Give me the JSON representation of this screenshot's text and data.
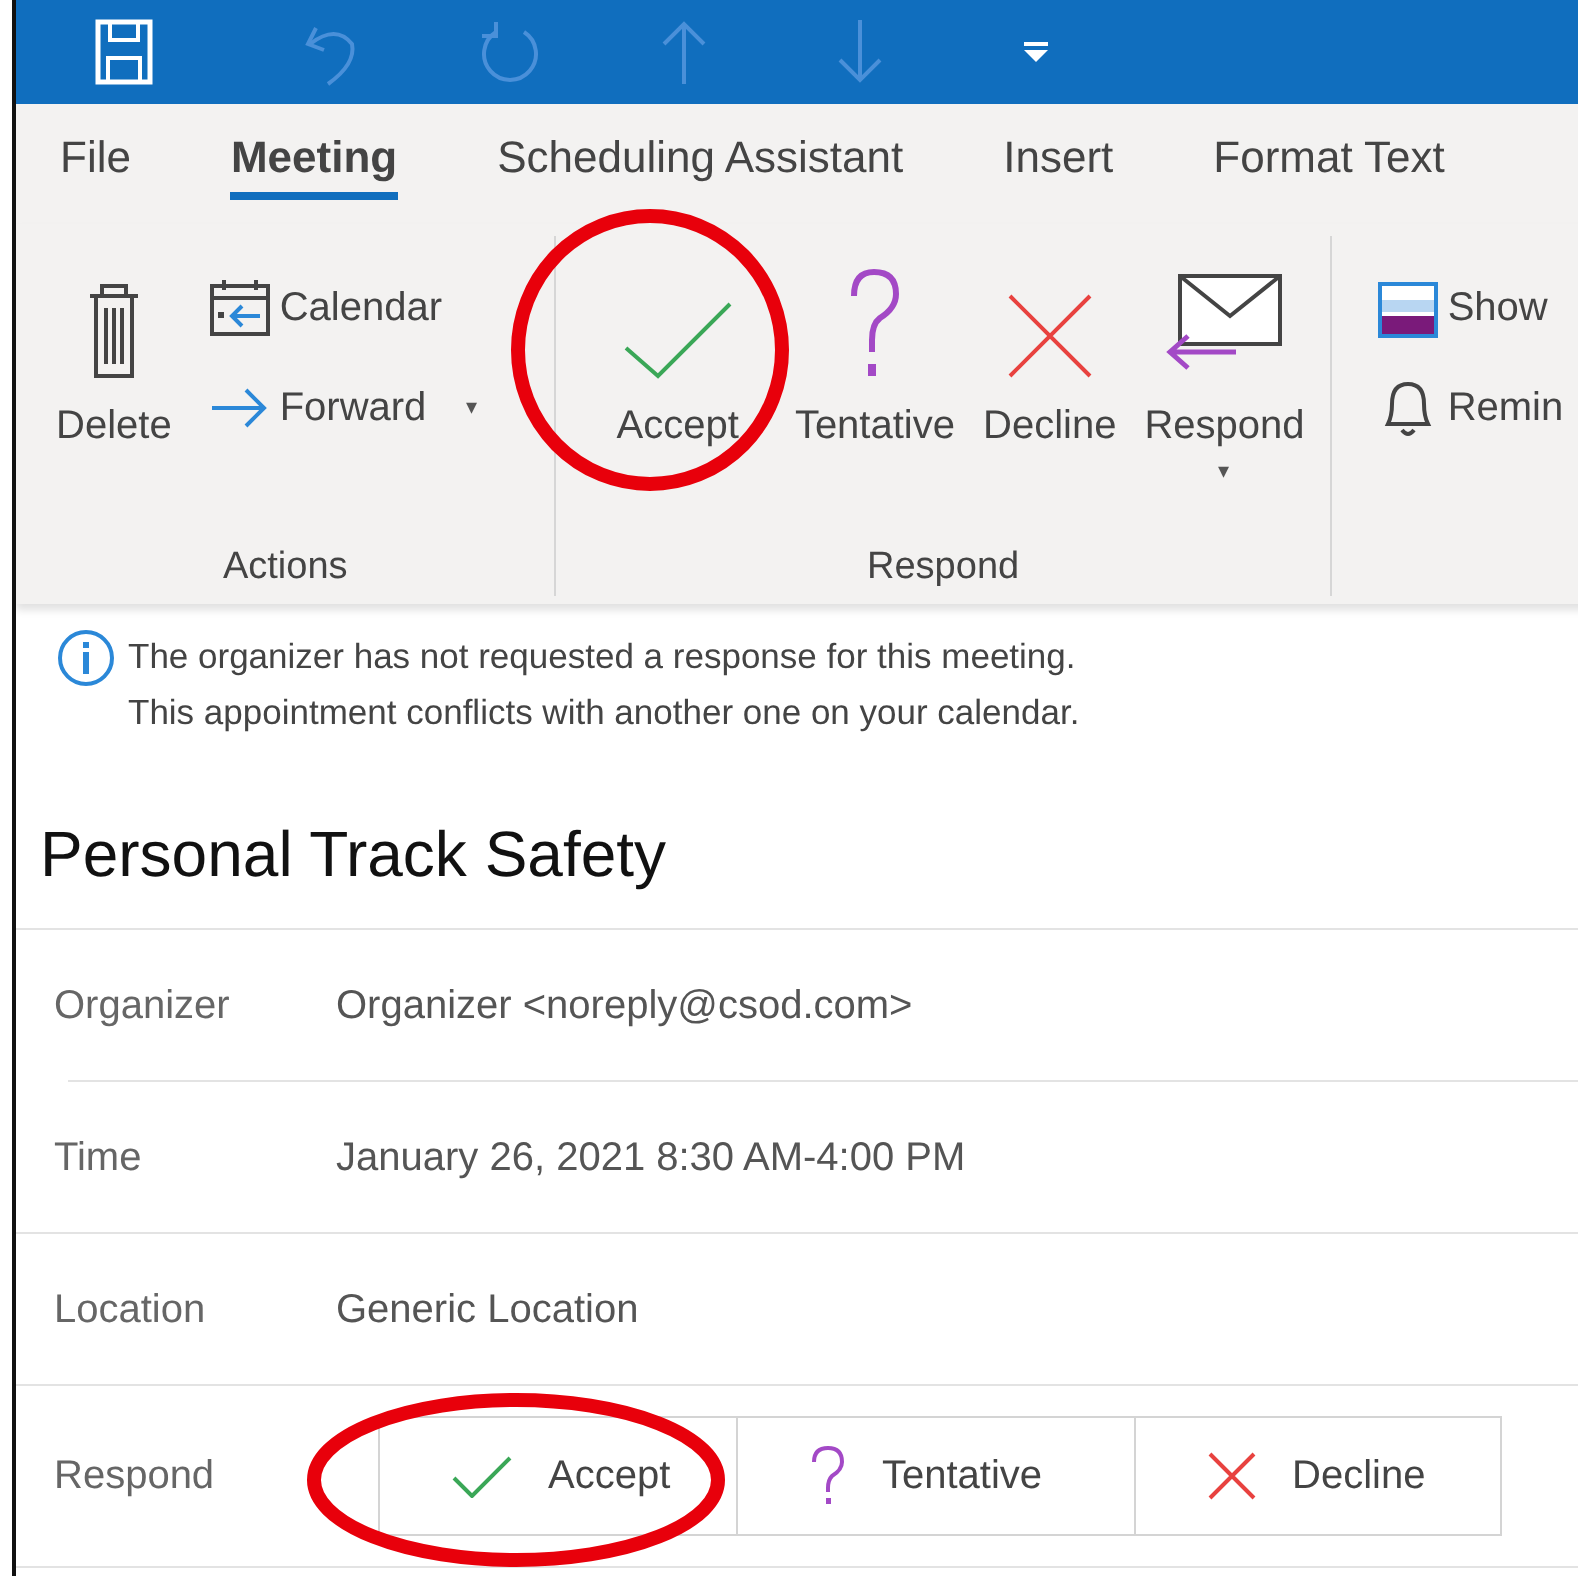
{
  "quick_access": [
    {
      "kind": "save"
    },
    {
      "kind": "undo"
    },
    {
      "kind": "redo"
    },
    {
      "kind": "up"
    },
    {
      "kind": "down"
    },
    {
      "kind": "customize"
    }
  ],
  "tabs": [
    {
      "label": "File",
      "selected": false
    },
    {
      "label": "Meeting",
      "selected": true
    },
    {
      "label": "Scheduling Assistant",
      "selected": false
    },
    {
      "label": "Insert",
      "selected": false
    },
    {
      "label": "Format Text",
      "selected": false
    }
  ],
  "ribbon_groups": [
    {
      "label": "Actions",
      "items": [
        {
          "kind": "large",
          "label": "Delete"
        },
        {
          "kind": "stack",
          "buttons": [
            {
              "label": "Calendar"
            },
            {
              "label": "Forward",
              "caret": "▾"
            }
          ]
        }
      ]
    },
    {
      "label": "Respond",
      "items": [
        {
          "kind": "large",
          "label": "Accept"
        },
        {
          "kind": "large",
          "label": "Tentative"
        },
        {
          "kind": "large",
          "label": "Decline"
        },
        {
          "kind": "large",
          "label": "Respond",
          "caret": "▾"
        }
      ]
    },
    {
      "items": [
        {
          "kind": "stack",
          "buttons": [
            {
              "label": "Show"
            },
            {
              "label": "Remin"
            }
          ]
        }
      ]
    }
  ],
  "info_messages": [
    "The organizer has not requested a response for this meeting.",
    "This appointment conflicts with another one on your calendar."
  ],
  "subject": "Personal Track Safety",
  "details": [
    {
      "label": "Organizer",
      "value": "Organizer <noreply@csod.com>"
    },
    {
      "label": "Time",
      "value": "January 26, 2021 8:30 AM-4:00 PM"
    },
    {
      "label": "Location",
      "value": "Generic Location"
    }
  ],
  "respond": {
    "label": "Respond",
    "buttons": [
      {
        "label": "Accept"
      },
      {
        "label": "Tentative"
      },
      {
        "label": "Decline"
      }
    ]
  }
}
